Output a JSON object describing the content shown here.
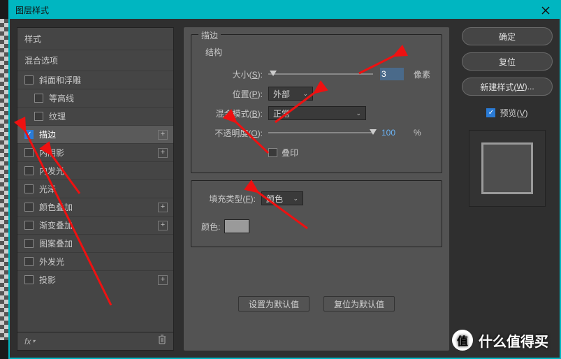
{
  "window": {
    "title": "图层样式"
  },
  "sidebar": {
    "header": "样式",
    "sub": "混合选项",
    "items": [
      {
        "label": "斜面和浮雕",
        "checked": false,
        "indent": false,
        "plus": false
      },
      {
        "label": "等高线",
        "checked": false,
        "indent": true,
        "plus": false
      },
      {
        "label": "纹理",
        "checked": false,
        "indent": true,
        "plus": false
      },
      {
        "label": "描边",
        "checked": true,
        "indent": false,
        "plus": true,
        "selected": true
      },
      {
        "label": "内阴影",
        "checked": false,
        "indent": false,
        "plus": true
      },
      {
        "label": "内发光",
        "checked": false,
        "indent": false,
        "plus": false
      },
      {
        "label": "光泽",
        "checked": false,
        "indent": false,
        "plus": false
      },
      {
        "label": "颜色叠加",
        "checked": false,
        "indent": false,
        "plus": true
      },
      {
        "label": "渐变叠加",
        "checked": false,
        "indent": false,
        "plus": true
      },
      {
        "label": "图案叠加",
        "checked": false,
        "indent": false,
        "plus": false
      },
      {
        "label": "外发光",
        "checked": false,
        "indent": false,
        "plus": false
      },
      {
        "label": "投影",
        "checked": false,
        "indent": false,
        "plus": true
      }
    ],
    "fx_label": "fx"
  },
  "panel": {
    "group_title": "描边",
    "structure_title": "结构",
    "size": {
      "label_pre": "大小(",
      "label_key": "S",
      "label_post": "):",
      "value": "3",
      "unit": "像素",
      "thumb_pct": 1
    },
    "position": {
      "label_pre": "位置(",
      "label_key": "P",
      "label_post": "):",
      "value": "外部"
    },
    "blend": {
      "label_pre": "混合模式(",
      "label_key": "B",
      "label_post": "):",
      "value": "正常"
    },
    "opacity": {
      "label_pre": "不透明度(",
      "label_key": "O",
      "label_post": "):",
      "value": "100",
      "unit": "%",
      "thumb_pct": 100
    },
    "overprint": {
      "label": "叠印"
    },
    "fill_type": {
      "label_pre": "填充类型(",
      "label_key": "F",
      "label_post": "):",
      "value": "颜色"
    },
    "color": {
      "label": "颜色:",
      "hex": "#9a9a9a"
    },
    "set_default": "设置为默认值",
    "reset_default": "复位为默认值"
  },
  "right": {
    "ok": "确定",
    "cancel": "复位",
    "new_style_pre": "新建样式(",
    "new_style_key": "W",
    "new_style_post": ")...",
    "preview_pre": "预览(",
    "preview_key": "V",
    "preview_post": ")"
  },
  "watermark": {
    "icon": "值",
    "text": "什么值得买"
  }
}
